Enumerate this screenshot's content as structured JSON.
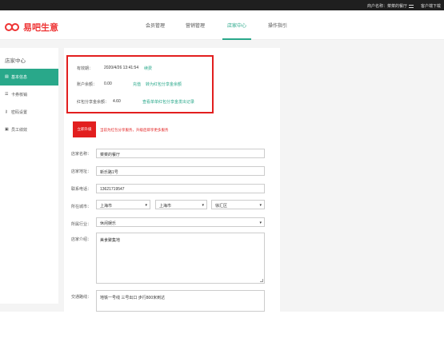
{
  "topbar": {
    "merchant_label": "商户名称：菜菜的餐厅",
    "download_label": "客户端下载"
  },
  "header": {
    "logo_text": "易吧生意",
    "nav": [
      {
        "label": "会员管理"
      },
      {
        "label": "营销管理"
      },
      {
        "label": "店家中心"
      },
      {
        "label": "操作指引"
      }
    ]
  },
  "sidebar": {
    "title": "店家中心",
    "items": [
      {
        "icon": "info-icon",
        "label": "基本信息"
      },
      {
        "icon": "card-icon",
        "label": "卡券核销"
      },
      {
        "icon": "key-icon",
        "label": "密码设置"
      },
      {
        "icon": "staff-icon",
        "label": "员工绩效"
      }
    ]
  },
  "account": {
    "valid_label": "有效期：",
    "valid_value": "2020/4/26 13:41:54",
    "renew_link": "续费",
    "balance_label": "账户余额：",
    "balance_value": "0.00",
    "recharge_link": "充值",
    "transfer_link": "转为红包分享金余额",
    "redpacket_label": "红包分享金余额：",
    "redpacket_value": "4.60",
    "redpacket_link": "查看单单红包分享金发出记录"
  },
  "upgrade": {
    "button": "立即升级",
    "note": "当前为红包分享服务，升级后即享更多服务"
  },
  "form": {
    "store_name_label": "店家名称：",
    "store_name_value": "菜菜的餐厅",
    "address_label": "店家地址：",
    "address_value": "新乐路1号",
    "phone_label": "联系电话：",
    "phone_value": "13621719547",
    "city_label": "所在城市：",
    "province_value": "上海市",
    "city_value": "上海市",
    "district_value": "徐汇区",
    "industry_label": "所属行业：",
    "industry_value": "休闲娱乐",
    "intro_label": "店家介绍：",
    "intro_value": "美食聚集地",
    "transport_label": "交通路线：",
    "transport_value": "地铁一号线 三号出口 步行800米到达"
  },
  "colors": {
    "accent": "#29a88a",
    "highlight": "#e21f1f"
  }
}
